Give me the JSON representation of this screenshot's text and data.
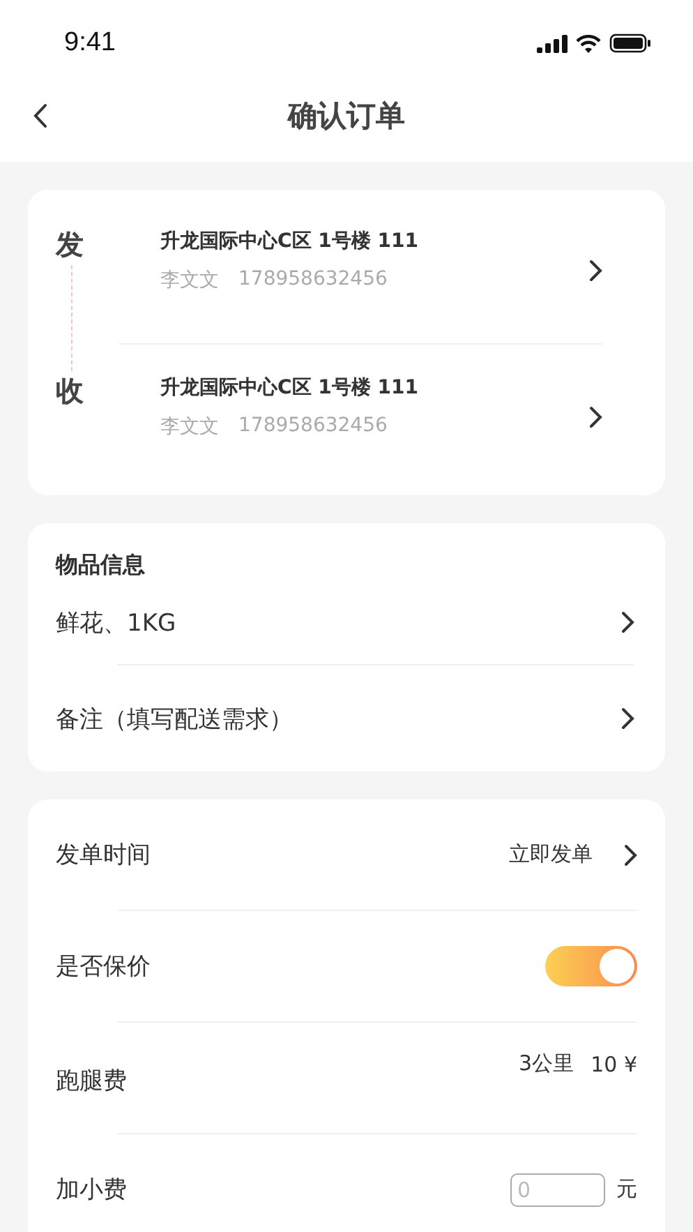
{
  "status_bar": {
    "time": "9:41"
  },
  "nav": {
    "title": "确认订单"
  },
  "addresses": [
    {
      "tag": "发",
      "address": "升龙国际中心C区 1号楼 111",
      "name": "李文文",
      "phone": "178958632456"
    },
    {
      "tag": "收",
      "address": "升龙国际中心C区 1号楼 111",
      "name": "李文文",
      "phone": "178958632456"
    }
  ],
  "goods": {
    "title": "物品信息",
    "rows": [
      {
        "label": "鲜花、1KG"
      },
      {
        "label": "备注（填写配送需求）"
      }
    ]
  },
  "options": [
    {
      "kind": "link",
      "label": "发单时间",
      "value": "立即发单"
    },
    {
      "kind": "toggle",
      "label": "是否保价",
      "on": true
    },
    {
      "kind": "fee",
      "label": "跑腿费",
      "distance": "3公里",
      "price": "10 ¥"
    },
    {
      "kind": "input",
      "label": "加小费",
      "placeholder": "0",
      "unit": "元"
    }
  ]
}
